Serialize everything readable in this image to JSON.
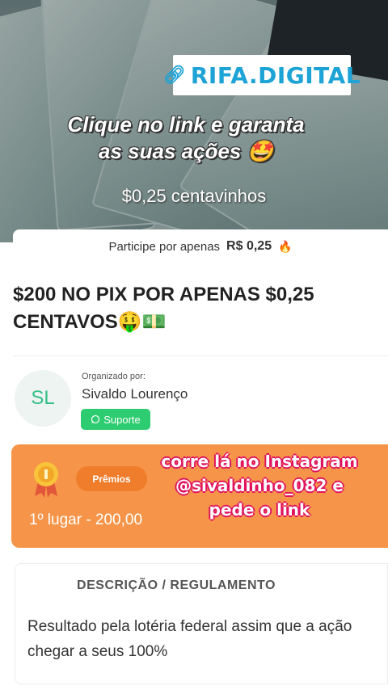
{
  "hero": {
    "tag_icon": "link-icon",
    "tag_text": "RIFA.DIGITAL",
    "headline_line1": "Clique no link e garanta",
    "headline_line2": "as suas ações 🤩",
    "subline": "$0,25 centavinhos"
  },
  "price": {
    "label": "Participe por apenas",
    "value": "R$ 0,25",
    "icon": "🔥"
  },
  "title": "$200 NO PIX POR APENAS $0,25 CENTAVOS🤑💵",
  "organizer": {
    "initials": "SL",
    "label": "Organizado por:",
    "name": "Sivaldo Lourenço",
    "support_label": "Suporte",
    "support_icon": "whatsapp-icon"
  },
  "prizes": {
    "badge": "Prêmios",
    "first_place": "1º lugar - 200,00",
    "overlay_line1": "corre lá no Instagram",
    "overlay_line2": "@sivaldinho_082 e",
    "overlay_line3": "pede o link",
    "colors": {
      "card": "#f69549",
      "badge": "#ef7d2c",
      "overlay_outline": "#e0135f"
    }
  },
  "description": {
    "title": "DESCRIÇÃO / REGULAMENTO",
    "body": "Resultado pela lotéria federal assim que a ação chegar a seus 100%"
  }
}
